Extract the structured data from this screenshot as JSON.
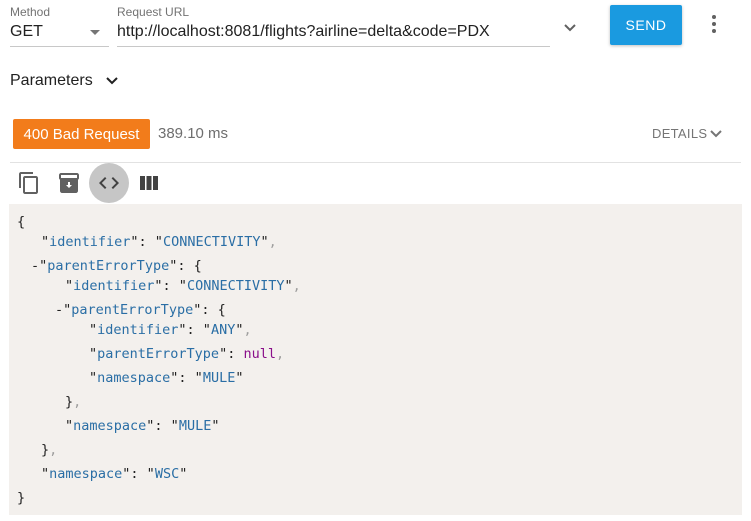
{
  "request": {
    "method_label": "Method",
    "method_value": "GET",
    "url_label": "Request URL",
    "url_value": "http://localhost:8081/flights?airline=delta&code=PDX",
    "send_label": "SEND"
  },
  "parameters": {
    "label": "Parameters"
  },
  "response": {
    "status": "400 Bad Request",
    "timing": "389.10 ms",
    "details_label": "DETAILS",
    "status_color": "#f27c1b"
  },
  "toolbar": {
    "icons": [
      "copy-icon",
      "save-icon",
      "code-view-icon",
      "columns-view-icon"
    ],
    "active": "code-view-icon"
  },
  "body_json": {
    "identifier": "CONNECTIVITY",
    "parentErrorType": {
      "identifier": "CONNECTIVITY",
      "parentErrorType": {
        "identifier": "ANY",
        "parentErrorType": "null",
        "namespace": "MULE"
      },
      "namespace": "MULE"
    },
    "namespace": "WSC"
  },
  "colors": {
    "accent": "#1a9ae0",
    "code_background": "#f3f0ed",
    "json_key": "#2a6ea5",
    "json_null": "#8a0f8a"
  }
}
